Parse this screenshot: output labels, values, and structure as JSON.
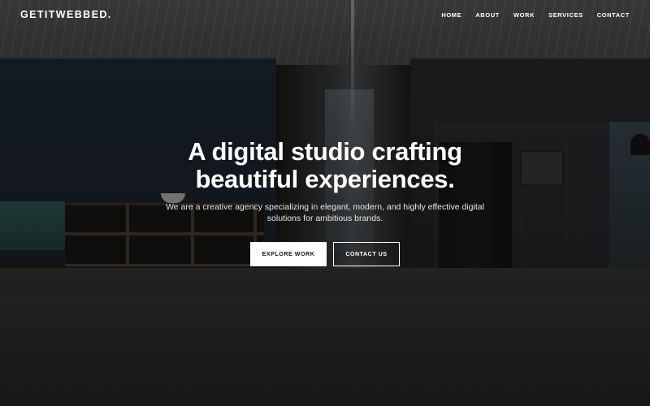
{
  "header": {
    "logo": "GETITWEBBED.",
    "nav": [
      "HOME",
      "ABOUT",
      "WORK",
      "SERVICES",
      "CONTACT"
    ]
  },
  "hero": {
    "headline": "A digital studio crafting beautiful experiences.",
    "subtext": "We are a creative agency specializing in elegant, modern, and highly effective digital solutions for ambitious brands.",
    "primary_button": "EXPLORE WORK",
    "secondary_button": "CONTACT US"
  },
  "colors": {
    "text": "#ffffff",
    "overlay": "#000000",
    "primary_button_bg": "#ffffff",
    "primary_button_text": "#111111"
  }
}
